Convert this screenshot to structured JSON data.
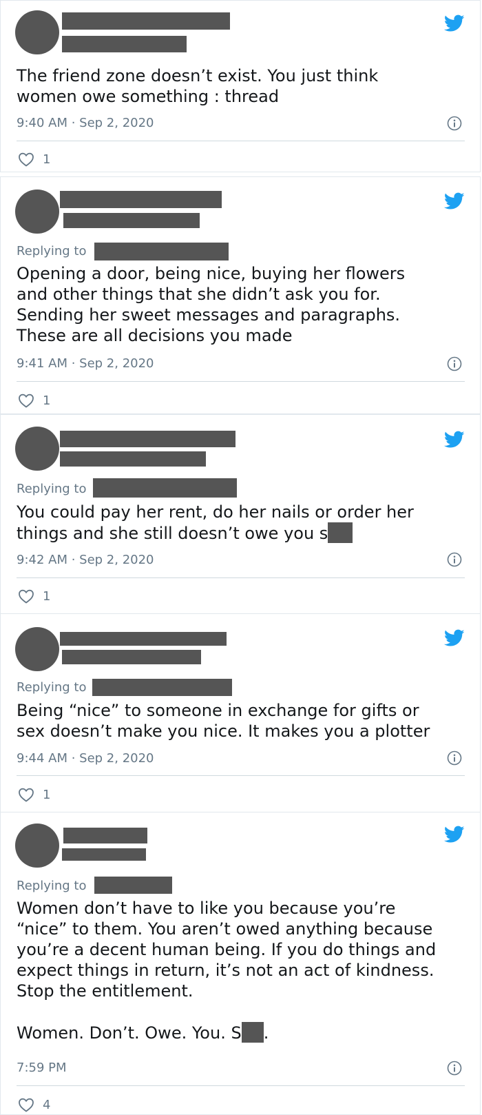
{
  "colors": {
    "twitter_blue": "#1da1f2",
    "redaction": "#555555",
    "meta_gray": "#657786"
  },
  "icons": {
    "brand": "twitter-bird-icon",
    "info": "info-icon",
    "like": "heart-icon"
  },
  "tweets": [
    {
      "replying_label": "",
      "text": "The friend zone doesn’t exist. You just think\nwomen owe something : thread",
      "time": "9:40 AM · Sep 2, 2020",
      "likes": "1"
    },
    {
      "replying_label": "Replying to",
      "text": "Opening a door, being nice, buying her flowers\nand other things that she didn’t ask you for.\nSending her sweet messages and paragraphs.\nThese are all decisions you made",
      "time": "9:41 AM · Sep 2, 2020",
      "likes": "1"
    },
    {
      "replying_label": "Replying to",
      "text_line1": "You could pay her rent, do her nails or order her",
      "text_line2": "things and she still doesn’t owe you s",
      "time": "9:42 AM · Sep 2, 2020",
      "likes": "1"
    },
    {
      "replying_label": "Replying to",
      "text": "Being “nice” to someone in exchange for gifts or\nsex doesn’t make you nice. It makes you a plotter",
      "time": "9:44 AM · Sep 2, 2020",
      "likes": "1"
    },
    {
      "replying_label": "Replying to",
      "text": "Women don’t have to like you because you’re\n“nice” to them. You aren’t owed anything because\nyou’re a decent human being. If you do things and\nexpect things in return, it’s not an act of kindness.\nStop the entitlement.",
      "text_last_a": "Women. Don’t. Owe. You. S",
      "text_last_b": ".",
      "time": "7:59 PM",
      "likes": "4"
    }
  ]
}
